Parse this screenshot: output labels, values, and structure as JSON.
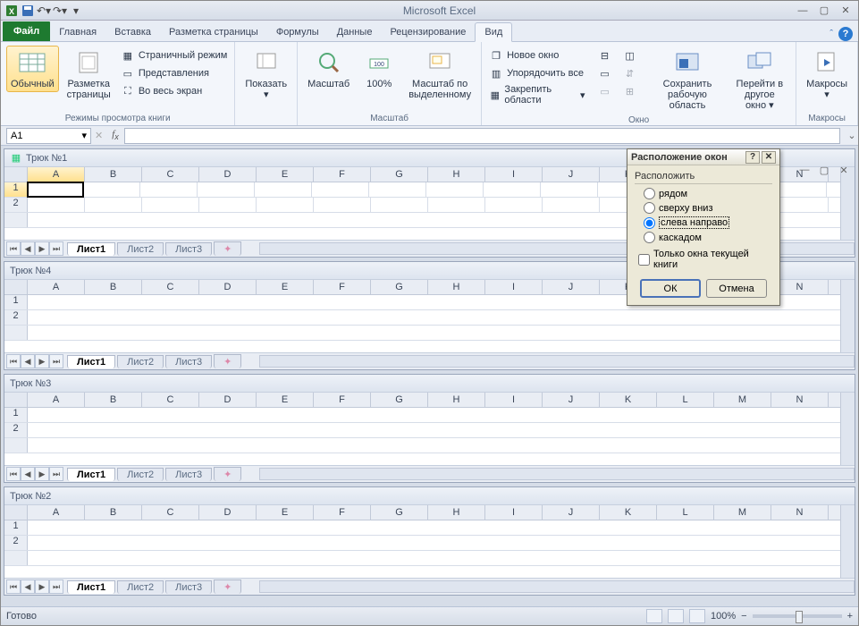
{
  "app": {
    "title": "Microsoft Excel"
  },
  "qat": {
    "save": "save",
    "undo": "undo",
    "redo": "redo"
  },
  "tabs": {
    "file": "Файл",
    "items": [
      "Главная",
      "Вставка",
      "Разметка страницы",
      "Формулы",
      "Данные",
      "Рецензирование",
      "Вид"
    ],
    "active_index": 6
  },
  "ribbon": {
    "views": {
      "normal": "Обычный",
      "page_layout": "Разметка\nстраницы",
      "page_break": "Страничный режим",
      "custom_views": "Представления",
      "full_screen": "Во весь экран",
      "group": "Режимы просмотра книги"
    },
    "show": {
      "btn": "Показать"
    },
    "zoom": {
      "zoom": "Масштаб",
      "hundred": "100%",
      "selection": "Масштаб по\nвыделенному",
      "group": "Масштаб"
    },
    "window": {
      "new": "Новое окно",
      "arrange": "Упорядочить все",
      "freeze": "Закрепить области",
      "save_ws": "Сохранить\nрабочую область",
      "switch": "Перейти в\nдругое окно",
      "group": "Окно"
    },
    "macros": {
      "btn": "Макросы",
      "group": "Макросы"
    }
  },
  "fbar": {
    "namebox": "A1"
  },
  "columns": [
    "A",
    "B",
    "C",
    "D",
    "E",
    "F",
    "G",
    "H",
    "I",
    "J",
    "K",
    "L",
    "M",
    "N"
  ],
  "rows2": [
    "1",
    "2"
  ],
  "sheets": [
    "Лист1",
    "Лист2",
    "Лист3"
  ],
  "workbooks": [
    {
      "title": "Трюк №1",
      "active_cell": true,
      "win_controls": true
    },
    {
      "title": "Трюк №4"
    },
    {
      "title": "Трюк №3"
    },
    {
      "title": "Трюк №2"
    }
  ],
  "dialog": {
    "title": "Расположение окон",
    "legend": "Расположить",
    "options": [
      "рядом",
      "сверху вниз",
      "слева направо",
      "каскадом"
    ],
    "selected": 2,
    "checkbox": "Только окна текущей книги",
    "ok": "ОК",
    "cancel": "Отмена"
  },
  "status": {
    "ready": "Готово",
    "zoom": "100%"
  }
}
